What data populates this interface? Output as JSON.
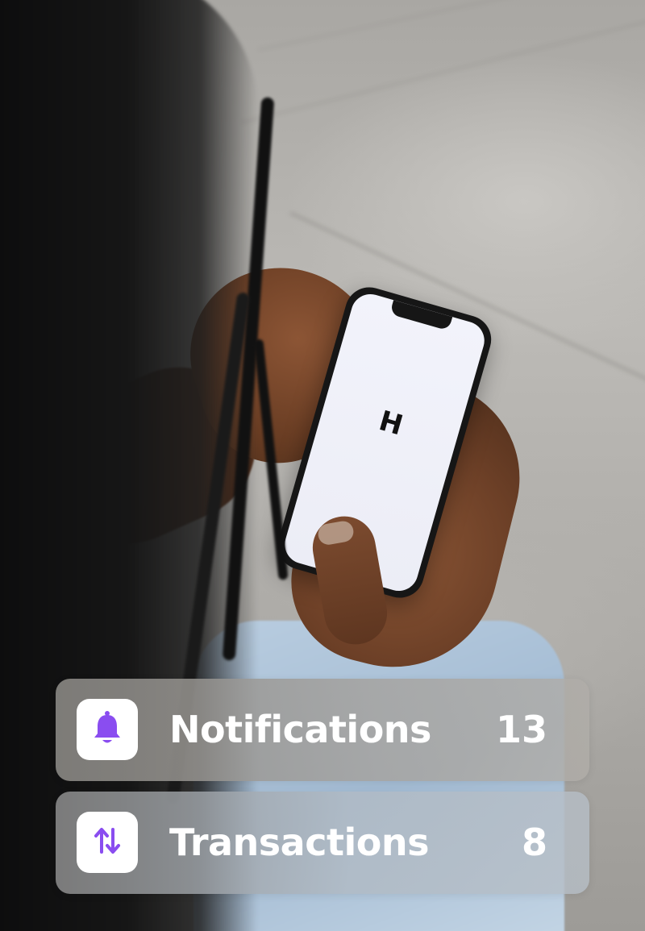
{
  "phone": {
    "logo_text": "H"
  },
  "cards": [
    {
      "label": "Notifications",
      "count": "13",
      "icon": "bell-icon",
      "icon_color": "#8a4df0"
    },
    {
      "label": "Transactions",
      "count": "8",
      "icon": "transfer-arrows-icon",
      "icon_color": "#8a4df0"
    }
  ],
  "colors": {
    "accent": "#8a4df0",
    "card_text": "#ffffff",
    "icon_tile": "#ffffff"
  }
}
